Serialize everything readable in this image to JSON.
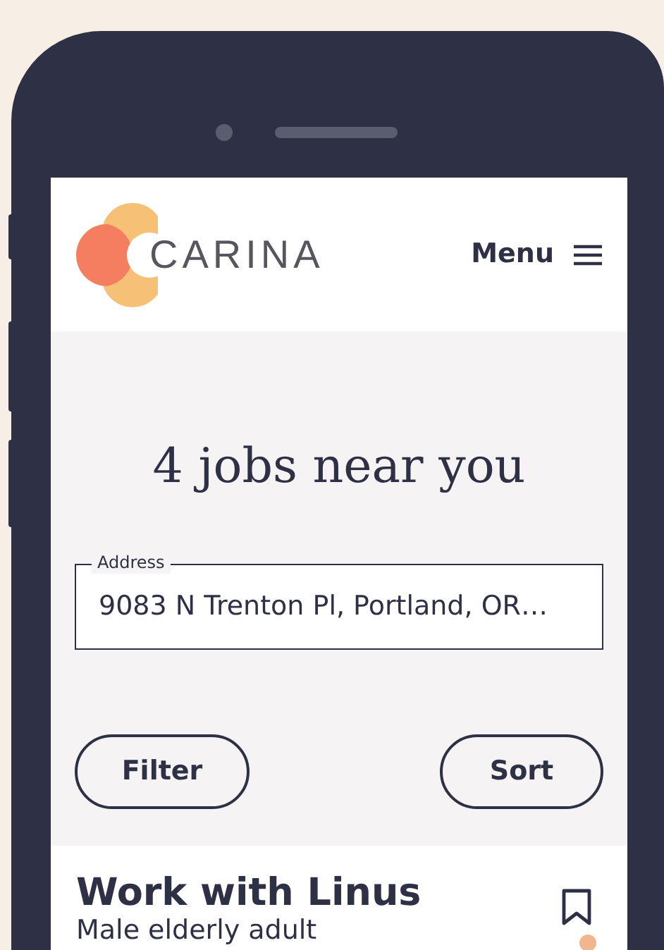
{
  "header": {
    "brand": "CARINA",
    "menu": "Menu"
  },
  "search": {
    "heading": "4 jobs near you",
    "address": {
      "label": "Address",
      "value": "9083 N Trenton Pl, Portland, OR…"
    },
    "buttons": [
      "Filter",
      "Sort"
    ]
  },
  "jobs": [
    {
      "title": "Work with Linus",
      "subtitle": "Male elderly adult"
    }
  ]
}
